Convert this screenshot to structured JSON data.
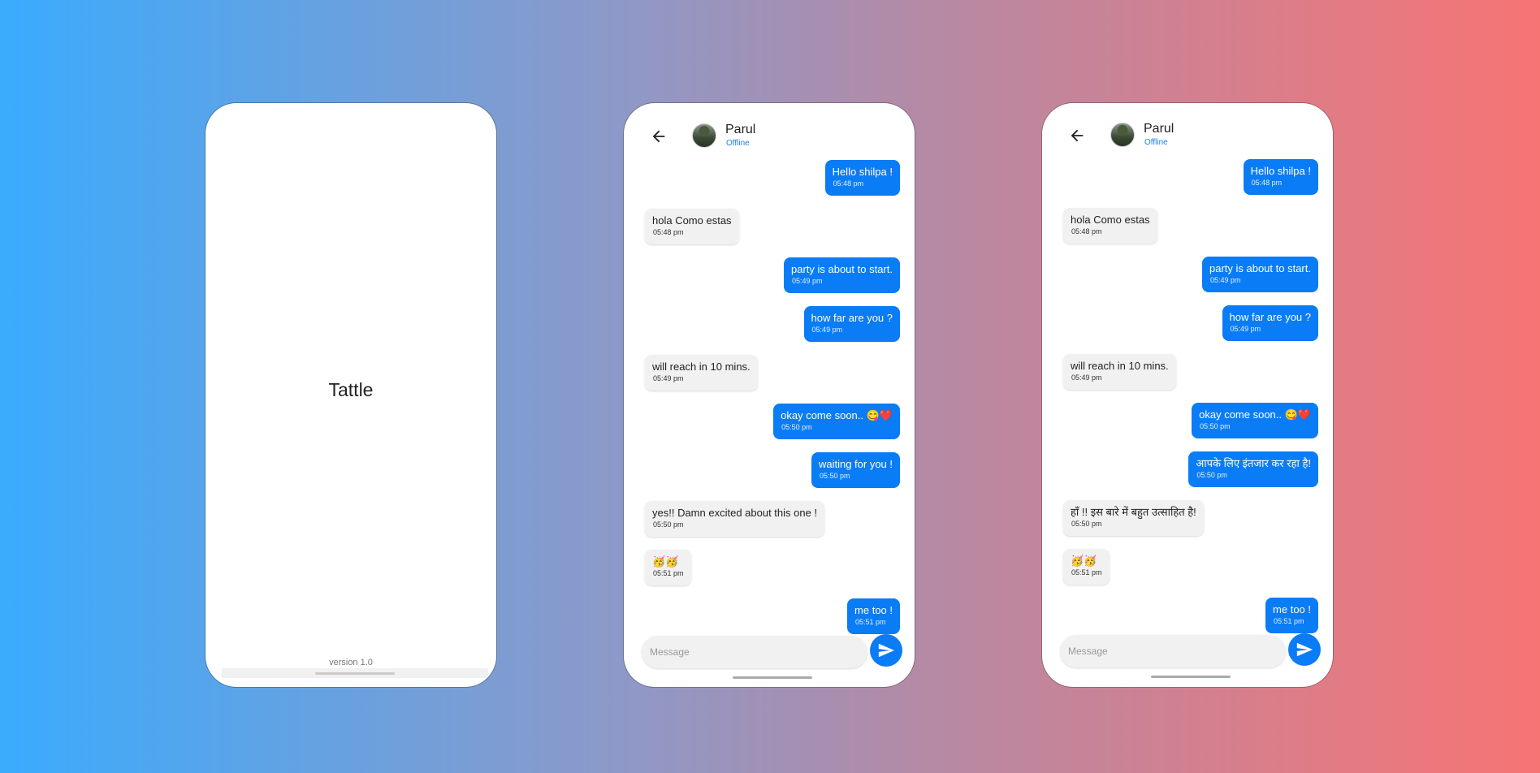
{
  "splash": {
    "app_name": "Tattle",
    "version": "version 1.0"
  },
  "chat_en": {
    "contact_name": "Parul",
    "contact_status": "Offline",
    "input_placeholder": "Message",
    "messages": [
      {
        "text": "Hello shilpa !",
        "time": "05:48 pm",
        "dir": "out"
      },
      {
        "text": "hola Como estas",
        "time": "05:48 pm",
        "dir": "in"
      },
      {
        "text": "party is about to start.",
        "time": "05:49 pm",
        "dir": "out"
      },
      {
        "text": "how far are you ?",
        "time": "05:49 pm",
        "dir": "out"
      },
      {
        "text": "will reach in 10 mins.",
        "time": "05:49 pm",
        "dir": "in"
      },
      {
        "text": "okay come soon.. 😋❤️",
        "time": "05:50 pm",
        "dir": "out"
      },
      {
        "text": "waiting for you !",
        "time": "05:50 pm",
        "dir": "out"
      },
      {
        "text": "yes!! Damn excited about this one !",
        "time": "05:50 pm",
        "dir": "in"
      },
      {
        "text": "🥳🥳",
        "time": "05:51 pm",
        "dir": "in"
      },
      {
        "text": "me too !",
        "time": "05:51 pm",
        "dir": "out"
      }
    ]
  },
  "chat_hi": {
    "contact_name": "Parul",
    "contact_status": "Offline",
    "input_placeholder": "Message",
    "messages": [
      {
        "text": "Hello shilpa !",
        "time": "05:48 pm",
        "dir": "out"
      },
      {
        "text": "hola Como estas",
        "time": "05:48 pm",
        "dir": "in"
      },
      {
        "text": "party is about to start.",
        "time": "05:49 pm",
        "dir": "out"
      },
      {
        "text": "how far are you ?",
        "time": "05:49 pm",
        "dir": "out"
      },
      {
        "text": "will reach in 10 mins.",
        "time": "05:49 pm",
        "dir": "in"
      },
      {
        "text": "okay come soon.. 😋❤️",
        "time": "05:50 pm",
        "dir": "out"
      },
      {
        "text": "आपके लिए इंतजार कर रहा है!",
        "time": "05:50 pm",
        "dir": "out"
      },
      {
        "text": "हाँ !! इस बारे में बहुत उत्साहित है!",
        "time": "05:50 pm",
        "dir": "in"
      },
      {
        "text": "🥳🥳",
        "time": "05:51 pm",
        "dir": "in"
      },
      {
        "text": "me too !",
        "time": "05:51 pm",
        "dir": "out"
      }
    ]
  },
  "colors": {
    "accent": "#0a7cf5",
    "incoming_bubble": "#f1f1f1",
    "status": "#1a7ff0"
  },
  "icons": {
    "back": "arrow-left-icon",
    "send": "send-icon"
  }
}
